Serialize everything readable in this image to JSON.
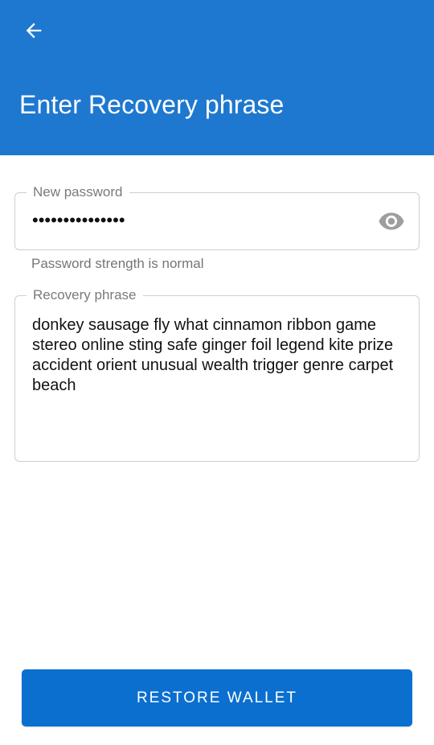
{
  "header": {
    "title": "Enter Recovery phrase",
    "back_icon": "arrow-left-icon",
    "background": "#1e78cf"
  },
  "password": {
    "label": "New password",
    "value": "•••••••••••••••",
    "helper": "Password strength is normal",
    "toggle_icon": "eye-icon"
  },
  "recovery": {
    "label": "Recovery phrase",
    "value": "donkey sausage fly what cinnamon ribbon game stereo online sting safe ginger foil legend kite prize accident orient unusual wealth trigger genre carpet beach"
  },
  "actions": {
    "restore_label": "RESTORE WALLET",
    "accent": "#0b6fcf"
  }
}
